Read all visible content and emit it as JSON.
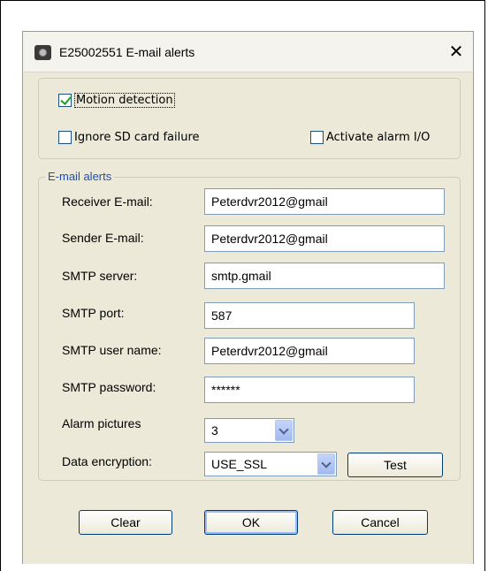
{
  "window": {
    "title": "E25002551 E-mail alerts",
    "close_symbol": "✕"
  },
  "options": {
    "motion_detection": {
      "label": "Motion detection",
      "checked": true
    },
    "ignore_sd": {
      "label": "Ignore SD card failure",
      "checked": false
    },
    "activate_alarm": {
      "label": "Activate alarm I/O",
      "checked": false
    }
  },
  "email_alerts": {
    "group_title": "E-mail alerts",
    "receiver_label": "Receiver E-mail:",
    "receiver_value": "Peterdvr2012@gmail",
    "sender_label": "Sender E-mail:",
    "sender_value": "Peterdvr2012@gmail",
    "smtp_server_label": "SMTP server:",
    "smtp_server_value": "smtp.gmail",
    "smtp_port_label": "SMTP port:",
    "smtp_port_value": "587",
    "smtp_user_label": "SMTP user name:",
    "smtp_user_value": "Peterdvr2012@gmail",
    "smtp_password_label": "SMTP password:",
    "smtp_password_value": "******",
    "alarm_pictures_label": "Alarm pictures",
    "alarm_pictures_value": "3",
    "encryption_label": "Data encryption:",
    "encryption_value": "USE_SSL",
    "test_label": "Test"
  },
  "footer": {
    "clear_label": "Clear",
    "ok_label": "OK",
    "cancel_label": "Cancel"
  }
}
